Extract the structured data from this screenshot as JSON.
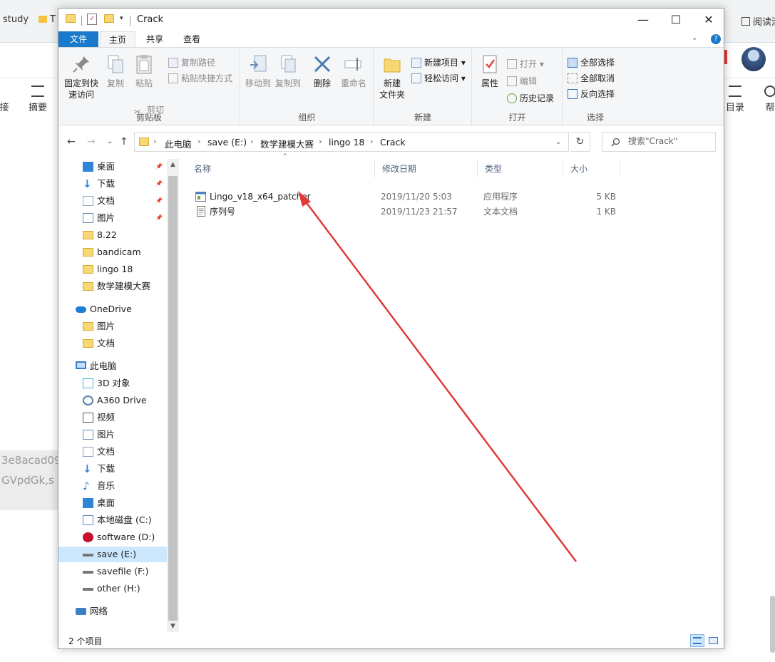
{
  "browser": {
    "bookmarks": [
      "study",
      "T"
    ],
    "reading_label": "阅读清",
    "left_tools": [
      "接",
      "摘要"
    ],
    "right_tools": [
      "目录",
      "帮"
    ],
    "bg_text_lines": [
      "3e8acad09",
      "GVpdGk,s"
    ]
  },
  "window": {
    "title": "Crack",
    "controls": {
      "minimize": "—",
      "maximize": "☐",
      "close": "✕"
    }
  },
  "ribbon": {
    "tabs": [
      "文件",
      "主页",
      "共享",
      "查看"
    ],
    "active_tab": "主页",
    "groups": {
      "clipboard": {
        "label": "剪贴板",
        "pin_line1": "固定到快",
        "pin_line2": "速访问",
        "copy": "复制",
        "paste": "粘贴",
        "copy_path": "复制路径",
        "paste_shortcut": "粘贴快捷方式",
        "cut": "剪切"
      },
      "organize": {
        "label": "组织",
        "move_to": "移动到",
        "copy_to": "复制到",
        "delete": "删除",
        "rename": "重命名"
      },
      "new": {
        "label": "新建",
        "new_folder_line1": "新建",
        "new_folder_line2": "文件夹",
        "new_item": "新建项目",
        "easy_access": "轻松访问"
      },
      "open": {
        "label": "打开",
        "properties": "属性",
        "open": "打开",
        "edit": "编辑",
        "history": "历史记录"
      },
      "select": {
        "label": "选择",
        "select_all": "全部选择",
        "select_none": "全部取消",
        "invert": "反向选择"
      }
    }
  },
  "navigation": {
    "breadcrumb": [
      "此电脑",
      "save (E:)",
      "数学建模大赛",
      "lingo 18",
      "Crack"
    ],
    "search_placeholder": "搜索\"Crack\""
  },
  "sidebar": {
    "quick_access": [
      {
        "label": "桌面",
        "icon": "desktop-icon",
        "pinned": true
      },
      {
        "label": "下载",
        "icon": "download-icon",
        "pinned": true
      },
      {
        "label": "文档",
        "icon": "document-icon",
        "pinned": true
      },
      {
        "label": "图片",
        "icon": "picture-icon",
        "pinned": true
      },
      {
        "label": "8.22",
        "icon": "folder-icon",
        "pinned": false
      },
      {
        "label": "bandicam",
        "icon": "folder-icon",
        "pinned": false
      },
      {
        "label": "lingo 18",
        "icon": "folder-icon",
        "pinned": false
      },
      {
        "label": "数学建模大赛",
        "icon": "folder-icon",
        "pinned": false
      }
    ],
    "onedrive": {
      "label": "OneDrive",
      "children": [
        "图片",
        "文档"
      ]
    },
    "this_pc": {
      "label": "此电脑",
      "children": [
        {
          "label": "3D 对象",
          "icon": "3d-objects-icon"
        },
        {
          "label": "A360 Drive",
          "icon": "a360-icon"
        },
        {
          "label": "视频",
          "icon": "video-icon"
        },
        {
          "label": "图片",
          "icon": "picture-icon"
        },
        {
          "label": "文档",
          "icon": "document-icon"
        },
        {
          "label": "下载",
          "icon": "download-icon"
        },
        {
          "label": "音乐",
          "icon": "music-icon"
        },
        {
          "label": "桌面",
          "icon": "desktop-icon"
        },
        {
          "label": "本地磁盘 (C:)",
          "icon": "windows-drive-icon"
        },
        {
          "label": "software (D:)",
          "icon": "software-drive-icon"
        },
        {
          "label": "save (E:)",
          "icon": "drive-icon",
          "selected": true
        },
        {
          "label": "savefile (F:)",
          "icon": "drive-icon"
        },
        {
          "label": "other (H:)",
          "icon": "drive-icon"
        }
      ]
    },
    "network": {
      "label": "网络"
    }
  },
  "file_list": {
    "columns": [
      "名称",
      "修改日期",
      "类型",
      "大小"
    ],
    "rows": [
      {
        "name": "Lingo_v18_x64_patcher",
        "date": "2019/11/20 5:03",
        "type": "应用程序",
        "size": "5 KB",
        "icon": "application-icon"
      },
      {
        "name": "序列号",
        "date": "2019/11/23 21:57",
        "type": "文本文档",
        "size": "1 KB",
        "icon": "text-file-icon"
      }
    ]
  },
  "status": {
    "item_count": "2 个项目"
  },
  "colors": {
    "accent": "#1979ca",
    "selection": "#cce8ff",
    "annotation": "#e03a3a",
    "folder": "#f8d775"
  }
}
